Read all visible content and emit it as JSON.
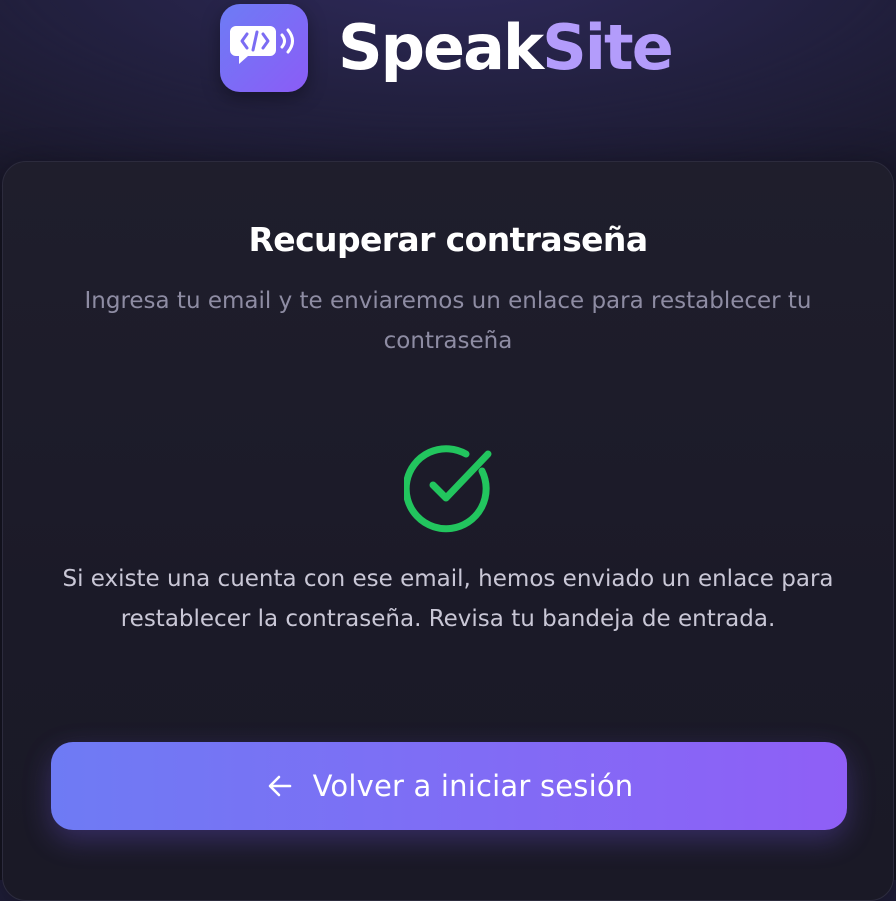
{
  "brand": {
    "name_part1": "Speak",
    "name_part2": "Site",
    "logo_icon": "code-speech-bubble-icon",
    "colors": {
      "logo_gradient_start": "#6d7cf5",
      "logo_gradient_end": "#8b5cf6",
      "accent_text": "#b39cfb"
    }
  },
  "card": {
    "title": "Recuperar contraseña",
    "subtitle": "Ingresa tu email y te enviaremos un enlace para restablecer tu contraseña",
    "status_icon": "check-circle-icon",
    "status_color": "#22c55e",
    "message": "Si existe una cuenta con ese email, hemos enviado un enlace para restablecer la contraseña. Revisa tu bandeja de entrada."
  },
  "button": {
    "label": "Volver a iniciar sesión",
    "icon": "arrow-left-icon"
  }
}
